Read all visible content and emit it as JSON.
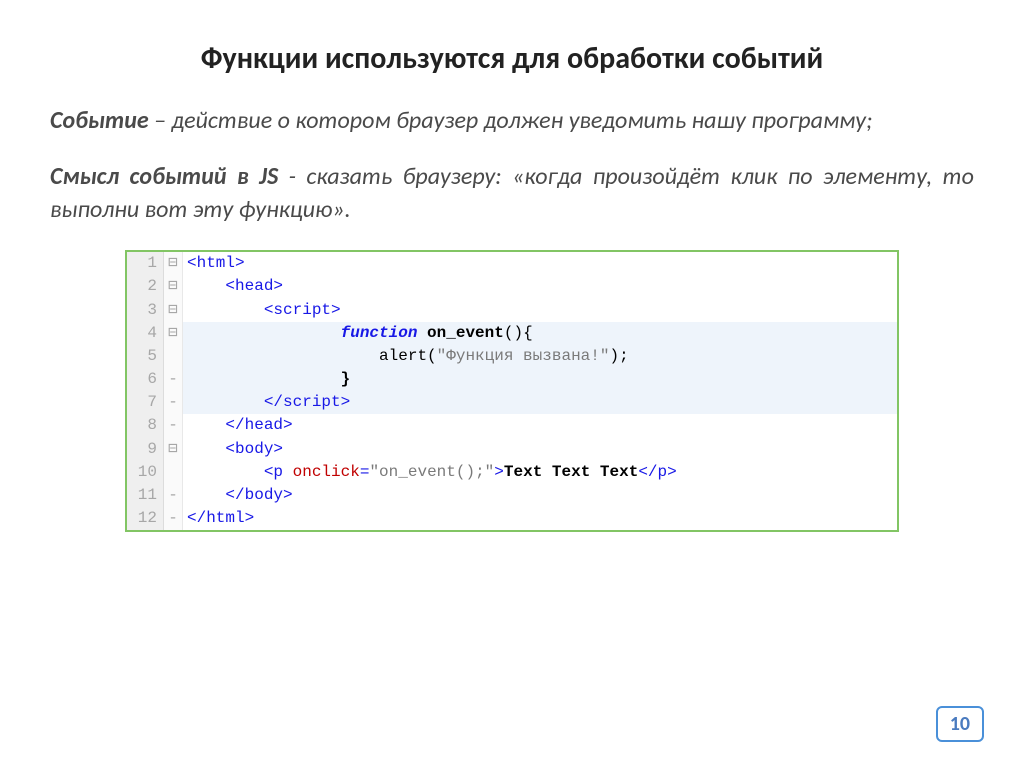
{
  "title": "Функции используются для обработки событий",
  "para1_strong": "Событие",
  "para1_rest": " – действие о котором браузер должен уведомить нашу программу;",
  "para2_strong": "Смысл событий в JS",
  "para2_rest": " - сказать браузеру: «когда произойдёт клик по элементу, то выполни вот эту функцию».",
  "page_number": "10",
  "code": {
    "lines": [
      {
        "n": "1",
        "fold": "⊟",
        "hl": false,
        "tokens": [
          [
            "tag",
            "<html>"
          ]
        ]
      },
      {
        "n": "2",
        "fold": "⊟",
        "hl": false,
        "tokens": [
          [
            "",
            "    "
          ],
          [
            "tag",
            "<head>"
          ]
        ]
      },
      {
        "n": "3",
        "fold": "⊟",
        "hl": false,
        "tokens": [
          [
            "",
            "        "
          ],
          [
            "tag",
            "<script>"
          ]
        ]
      },
      {
        "n": "4",
        "fold": "⊟",
        "hl": true,
        "tokens": [
          [
            "",
            "                "
          ],
          [
            "kw",
            "function"
          ],
          [
            "",
            " "
          ],
          [
            "fn",
            "on_event"
          ],
          [
            "fn2",
            "(){"
          ]
        ]
      },
      {
        "n": "5",
        "fold": "",
        "hl": true,
        "tokens": [
          [
            "",
            "                    "
          ],
          [
            "fn2",
            "alert("
          ],
          [
            "str",
            "\"Функция вызвана!\""
          ],
          [
            "fn2",
            ");"
          ]
        ]
      },
      {
        "n": "6",
        "fold": "-",
        "hl": true,
        "tokens": [
          [
            "",
            "                "
          ],
          [
            "fn",
            "}"
          ]
        ]
      },
      {
        "n": "7",
        "fold": "-",
        "hl": true,
        "tokens": [
          [
            "",
            "        "
          ],
          [
            "tag",
            "</script"
          ],
          [
            "tag",
            ">"
          ]
        ]
      },
      {
        "n": "8",
        "fold": "-",
        "hl": false,
        "tokens": [
          [
            "",
            "    "
          ],
          [
            "tag",
            "</head>"
          ]
        ]
      },
      {
        "n": "9",
        "fold": "⊟",
        "hl": false,
        "tokens": [
          [
            "",
            "    "
          ],
          [
            "tag",
            "<body>"
          ]
        ]
      },
      {
        "n": "10",
        "fold": "",
        "hl": false,
        "tokens": [
          [
            "",
            "        "
          ],
          [
            "tag",
            "<p "
          ],
          [
            "attr",
            "onclick"
          ],
          [
            "tag",
            "="
          ],
          [
            "str",
            "\"on_event();\""
          ],
          [
            "tag",
            ">"
          ],
          [
            "txt",
            "Text Text Text"
          ],
          [
            "tag",
            "</p>"
          ]
        ]
      },
      {
        "n": "11",
        "fold": "-",
        "hl": false,
        "tokens": [
          [
            "",
            "    "
          ],
          [
            "tag",
            "</body>"
          ]
        ]
      },
      {
        "n": "12",
        "fold": "-",
        "hl": false,
        "tokens": [
          [
            "tag",
            "</html>"
          ]
        ]
      }
    ]
  }
}
